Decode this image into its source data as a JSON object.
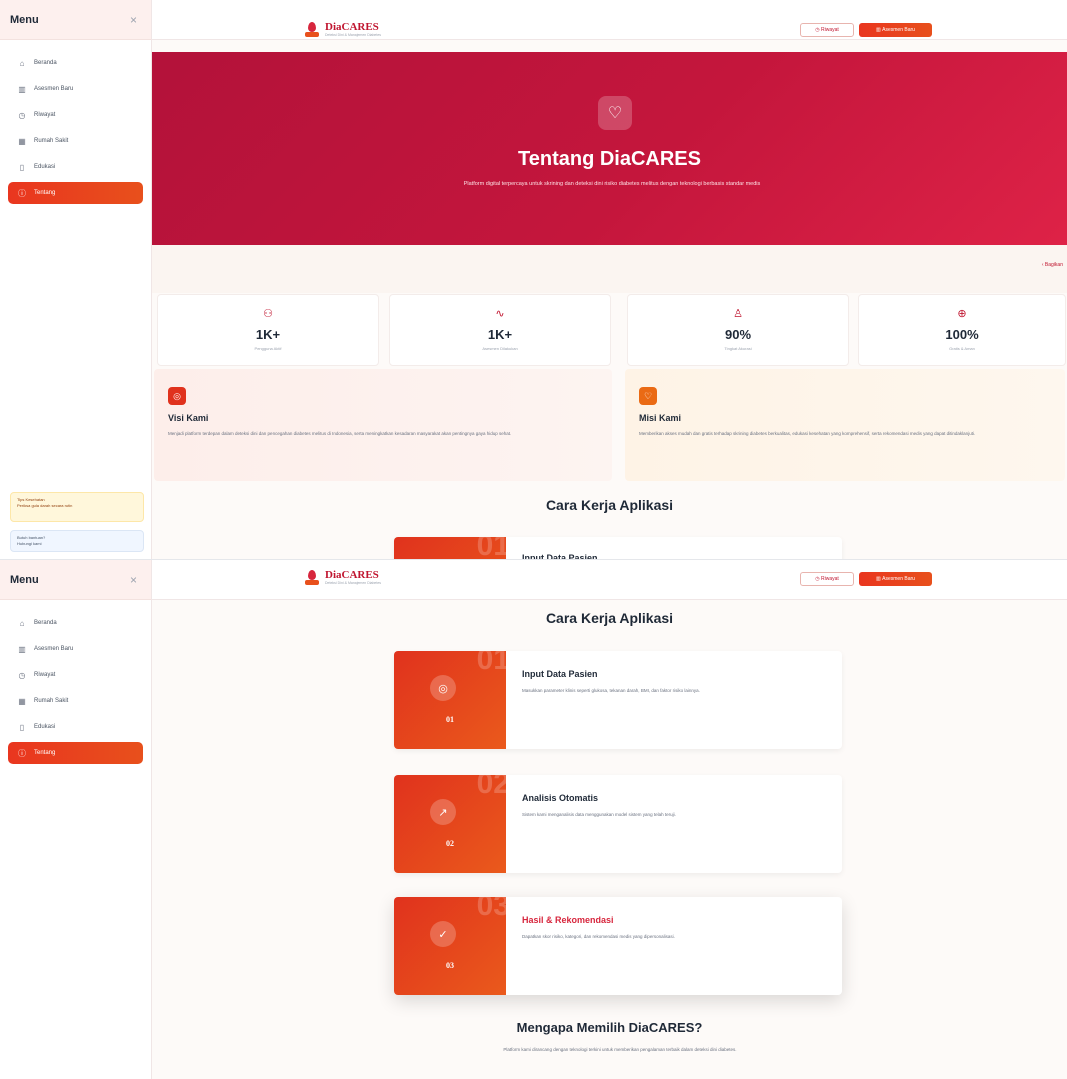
{
  "app": {
    "brand": "DiaCARES",
    "tagline": "Deteksi Dini & Manajemen Diabetes"
  },
  "sidebar": {
    "title": "Menu",
    "close_icon": "×",
    "items": [
      {
        "label": "Beranda",
        "icon": "home-icon",
        "glyph": "⌂"
      },
      {
        "label": "Asesmen Baru",
        "icon": "chart-icon",
        "glyph": "▥"
      },
      {
        "label": "Riwayat",
        "icon": "history-icon",
        "glyph": "◷"
      },
      {
        "label": "Rumah Sakit",
        "icon": "hospital-icon",
        "glyph": "▦"
      },
      {
        "label": "Edukasi",
        "icon": "book-icon",
        "glyph": "▯"
      },
      {
        "label": "Tentang",
        "icon": "info-icon",
        "glyph": "ⓘ"
      }
    ],
    "active_index": 5,
    "tip_title": "Tips Kesehatan",
    "tip_text": "Periksa gula darah secara rutin",
    "help_title": "Butuh bantuan?",
    "help_text": "Hubungi kami"
  },
  "topbar": {
    "riwayat_label": "Riwayat",
    "asesmen_label": "Asesmen Baru"
  },
  "hero": {
    "icon": "heart-icon",
    "title": "Tentang DiaCARES",
    "subtitle": "Platform digital terpercaya untuk skrining dan deteksi dini risiko diabetes melitus dengan teknologi berbasis standar medis"
  },
  "share_label": "Bagikan",
  "stats": [
    {
      "icon": "users-icon",
      "glyph": "⚇",
      "value": "1K+",
      "label": "Pengguna Aktif"
    },
    {
      "icon": "activity-icon",
      "glyph": "∿",
      "value": "1K+",
      "label": "Asesmen Dilakukan"
    },
    {
      "icon": "award-icon",
      "glyph": "♙",
      "value": "90%",
      "label": "Tingkat Akurasi"
    },
    {
      "icon": "globe-icon",
      "glyph": "⊕",
      "value": "100%",
      "label": "Gratis & Aman"
    }
  ],
  "visi": {
    "icon": "target-icon",
    "title": "Visi Kami",
    "text": "Menjadi platform terdepan dalam deteksi dini dan pencegahan diabetes melitus di Indonesia, serta meningkatkan kesadaran masyarakat akan pentingnya gaya hidup sehat."
  },
  "misi": {
    "icon": "heart-icon",
    "title": "Misi Kami",
    "text": "Memberikan akses mudah dan gratis terhadap skrining diabetes berkualitas, edukasi kesehatan yang komprehensif, serta rekomendasi medis yang dapat ditindaklanjuti."
  },
  "cara_kerja": {
    "title": "Cara Kerja Aplikasi",
    "steps": [
      {
        "num": "01",
        "icon": "target-icon",
        "glyph": "◎",
        "title": "Input Data Pasien",
        "desc": "Masukkan parameter klinis seperti glukosa, tekanan darah, BMI, dan faktor risiko lainnya."
      },
      {
        "num": "02",
        "icon": "trending-up-icon",
        "glyph": "↗",
        "title": "Analisis Otomatis",
        "desc": "Sistem kami menganalisis data menggunakan model sistem yang telah teruji."
      },
      {
        "num": "03",
        "icon": "check-circle-icon",
        "glyph": "✓",
        "title": "Hasil & Rekomendasi",
        "desc": "Dapatkan skor risiko, kategori, dan rekomendasi medis yang dipersonalisasi."
      }
    ]
  },
  "why": {
    "title": "Mengapa Memilih DiaCARES?",
    "subtitle": "Platform kami dirancang dengan teknologi terkini untuk memberikan pengalaman terbaik dalam deteksi dini diabetes."
  },
  "colors": {
    "brand": "#c0152f",
    "accent": "#e8501c",
    "hero": "#c4163c"
  }
}
